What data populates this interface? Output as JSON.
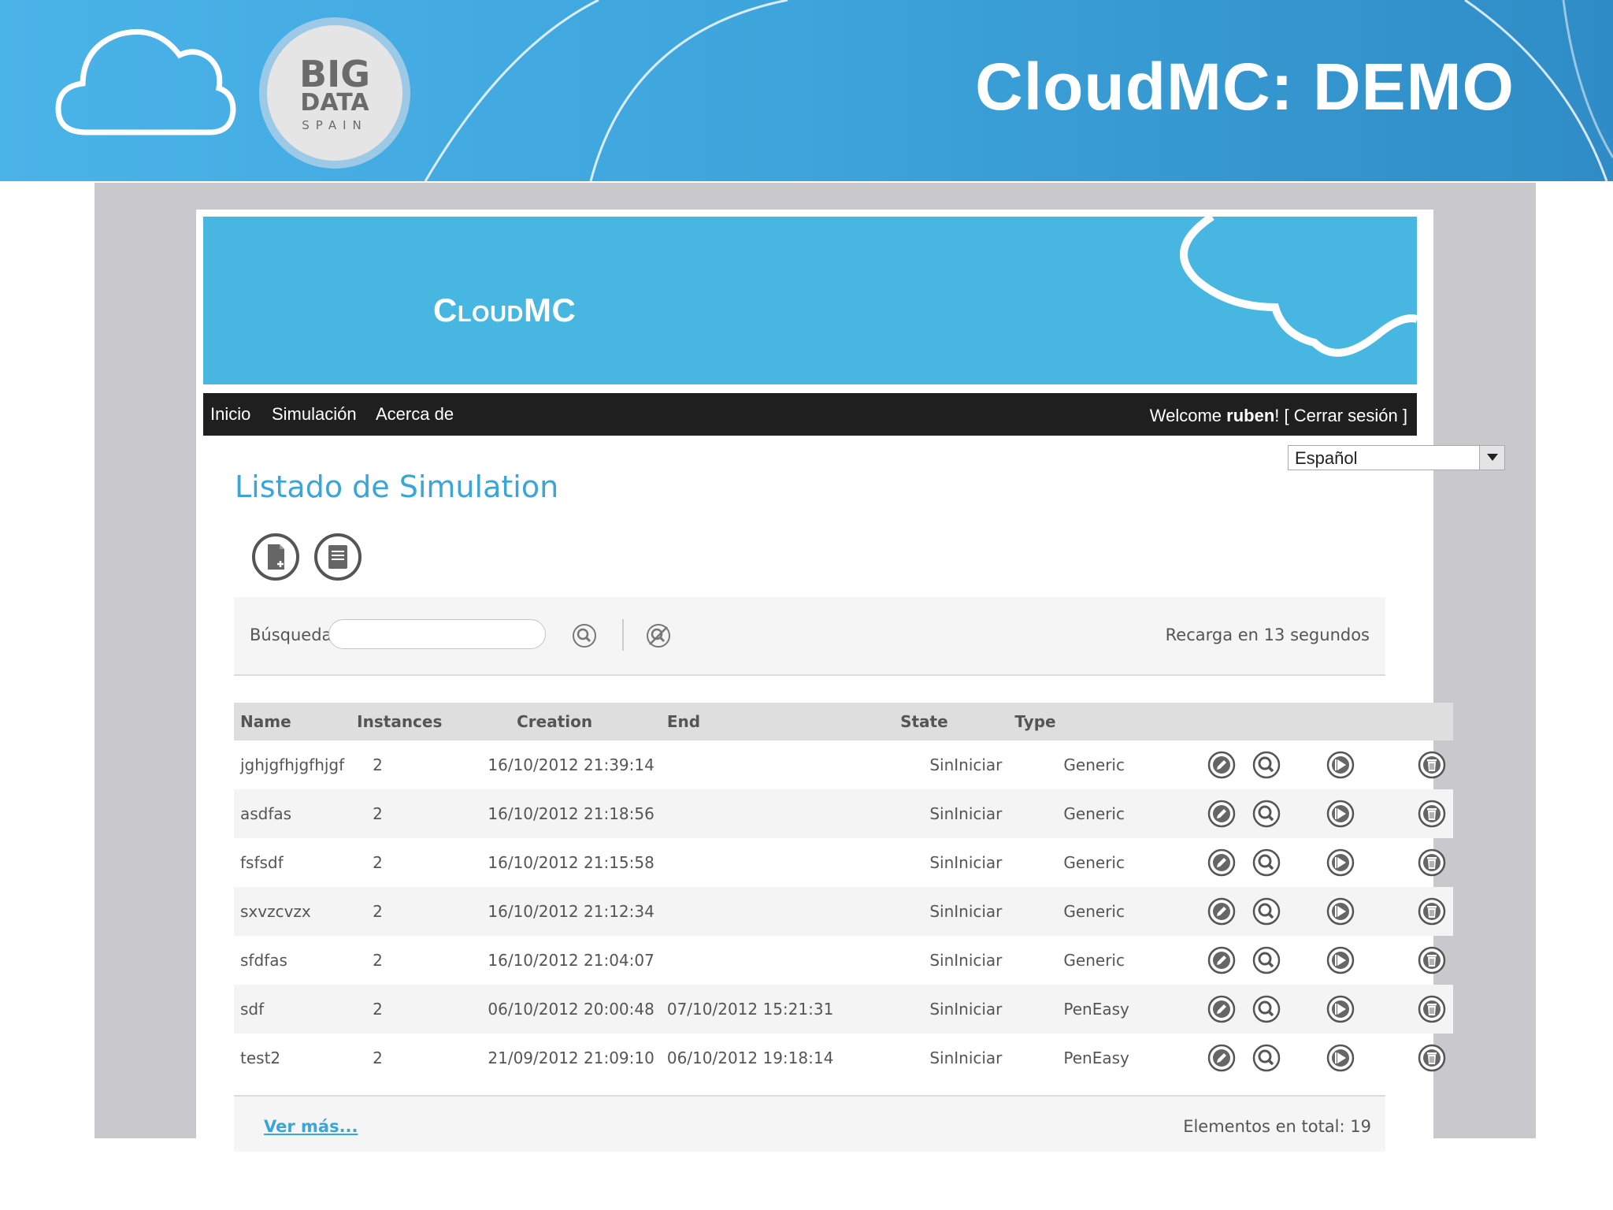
{
  "slide": {
    "title": "CloudMC: DEMO",
    "logo_line1": "BIG",
    "logo_line2": "DATA",
    "logo_line3": "SPAIN"
  },
  "app": {
    "logo_prefix": "Cloud",
    "logo_suffix": "MC"
  },
  "nav": {
    "items": [
      "Inicio",
      "Simulación",
      "Acerca de"
    ],
    "welcome_prefix": "Welcome ",
    "username": "ruben",
    "welcome_suffix": "! ",
    "logout": "[ Cerrar sesión ]"
  },
  "language": {
    "selected": "Español"
  },
  "list": {
    "title": "Listado de Simulation"
  },
  "search": {
    "label": "Búsqueda",
    "value": "",
    "reload_text": "Recarga en 13 segundos"
  },
  "table": {
    "headers": [
      "Name",
      "Instances",
      "Creation",
      "End",
      "State",
      "Type"
    ],
    "rows": [
      {
        "name": "jghjgfhjgfhjgf",
        "instances": "2",
        "creation": "16/10/2012 21:39:14",
        "end": "",
        "state": "SinIniciar",
        "type": "Generic"
      },
      {
        "name": "asdfas",
        "instances": "2",
        "creation": "16/10/2012 21:18:56",
        "end": "",
        "state": "SinIniciar",
        "type": "Generic"
      },
      {
        "name": "fsfsdf",
        "instances": "2",
        "creation": "16/10/2012 21:15:58",
        "end": "",
        "state": "SinIniciar",
        "type": "Generic"
      },
      {
        "name": "sxvzcvzx",
        "instances": "2",
        "creation": "16/10/2012 21:12:34",
        "end": "",
        "state": "SinIniciar",
        "type": "Generic"
      },
      {
        "name": "sfdfas",
        "instances": "2",
        "creation": "16/10/2012 21:04:07",
        "end": "",
        "state": "SinIniciar",
        "type": "Generic"
      },
      {
        "name": "sdf",
        "instances": "2",
        "creation": "06/10/2012 20:00:48",
        "end": "07/10/2012 15:21:31",
        "state": "SinIniciar",
        "type": "PenEasy"
      },
      {
        "name": "test2",
        "instances": "2",
        "creation": "21/09/2012 21:09:10",
        "end": "06/10/2012 19:18:14",
        "state": "SinIniciar",
        "type": "PenEasy"
      }
    ]
  },
  "footer": {
    "more_link": "Ver más...",
    "total_label": "Elementos en total: 19"
  },
  "colors": {
    "banner": "#3fa6dd",
    "app_header": "#47b6e1",
    "navbar": "#1f1f1f",
    "accent": "#3aa5d6"
  }
}
